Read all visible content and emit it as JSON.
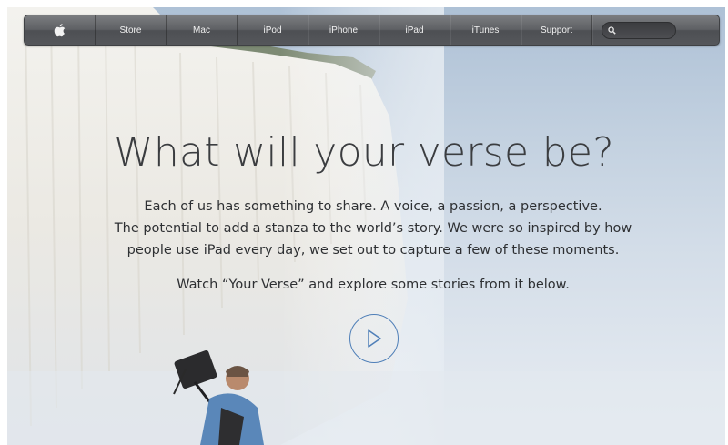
{
  "nav": {
    "items": [
      {
        "label": "Store"
      },
      {
        "label": "Mac"
      },
      {
        "label": "iPod"
      },
      {
        "label": "iPhone"
      },
      {
        "label": "iPad"
      },
      {
        "label": "iTunes"
      },
      {
        "label": "Support"
      }
    ],
    "search_placeholder": ""
  },
  "hero": {
    "headline": "What will your verse be?",
    "paragraph_lines": [
      "Each of us has something to share. A voice, a passion, a perspective.",
      "The potential to add a stanza to the world’s story. We were so inspired by how",
      "people use iPad every day, we set out to capture a few of these moments."
    ],
    "cta_text": "Watch “Your Verse” and explore some stories from it below."
  },
  "icons": {
    "logo": "apple-logo-icon",
    "search": "search-icon",
    "play": "play-icon"
  },
  "colors": {
    "nav_bar": "#5e6064",
    "play_accent": "#4f7fb8",
    "text": "#2e3033"
  }
}
